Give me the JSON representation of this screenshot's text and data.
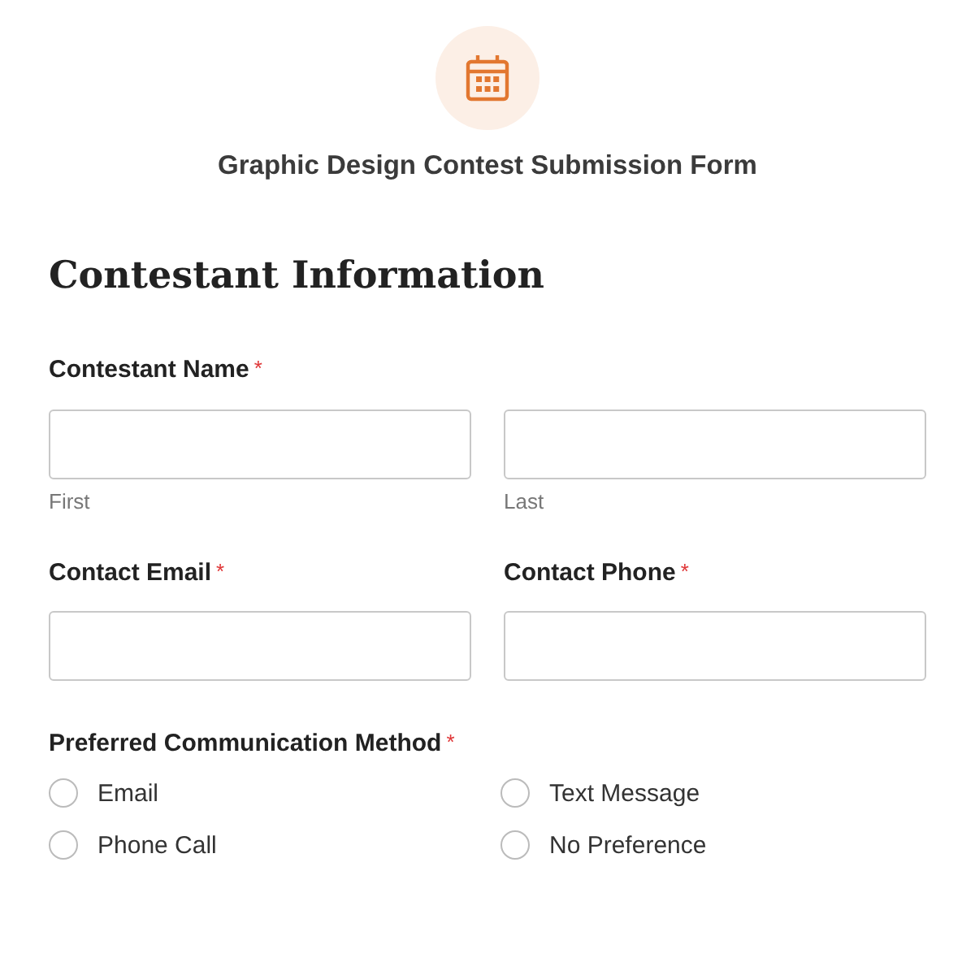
{
  "form": {
    "title": "Graphic Design Contest Submission Form"
  },
  "section": {
    "heading": "Contestant Information"
  },
  "fields": [
    {
      "kind": "name",
      "label": "Contestant Name",
      "required_mark": "*",
      "sublabels": [
        "First",
        "Last"
      ]
    },
    {
      "kind": "pair",
      "items": [
        {
          "label": "Contact Email",
          "required_mark": "*"
        },
        {
          "label": "Contact Phone",
          "required_mark": "*"
        }
      ]
    },
    {
      "kind": "radio",
      "label": "Preferred Communication Method",
      "required_mark": "*",
      "options": [
        {
          "label": "Email",
          "selected": false
        },
        {
          "label": "Text Message",
          "selected": false
        },
        {
          "label": "Phone Call",
          "selected": false
        },
        {
          "label": "No Preference",
          "selected": false
        }
      ]
    }
  ]
}
